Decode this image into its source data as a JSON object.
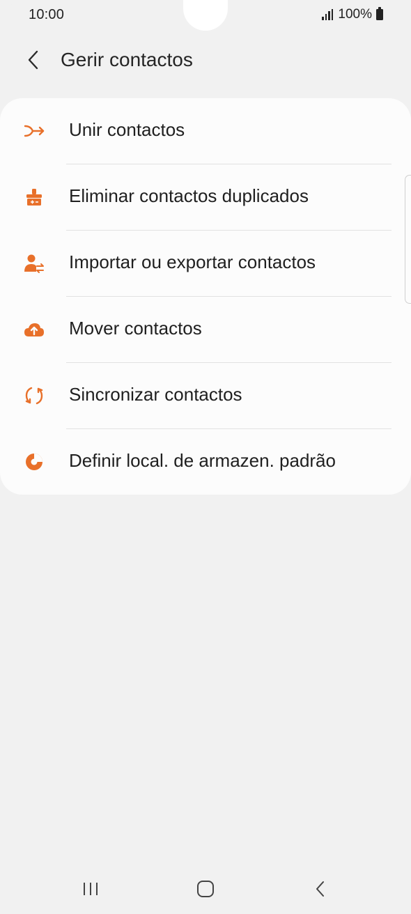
{
  "status_bar": {
    "time": "10:00",
    "battery": "100%",
    "icons": [
      "signal-icon",
      "battery-icon"
    ]
  },
  "header": {
    "back_icon": "chevron-left-icon",
    "title": "Gerir contactos"
  },
  "menu": {
    "items": [
      {
        "label": "Unir contactos",
        "icon": "merge-icon"
      },
      {
        "label": "Eliminar contactos duplicados",
        "icon": "broom-icon"
      },
      {
        "label": "Importar ou exportar contactos",
        "icon": "person-transfer-icon"
      },
      {
        "label": "Mover contactos",
        "icon": "cloud-upload-icon"
      },
      {
        "label": "Sincronizar contactos",
        "icon": "sync-icon"
      },
      {
        "label": "Definir local. de armazen. padrão",
        "icon": "storage-pie-icon"
      }
    ]
  },
  "navigation": {
    "buttons": [
      "recents-icon",
      "home-icon",
      "back-icon"
    ]
  },
  "colors": {
    "accent": "#e8702a",
    "background": "#f1f1f1",
    "card": "#fcfcfc",
    "text": "#1f1f1f",
    "divider": "#e2e2e2"
  }
}
